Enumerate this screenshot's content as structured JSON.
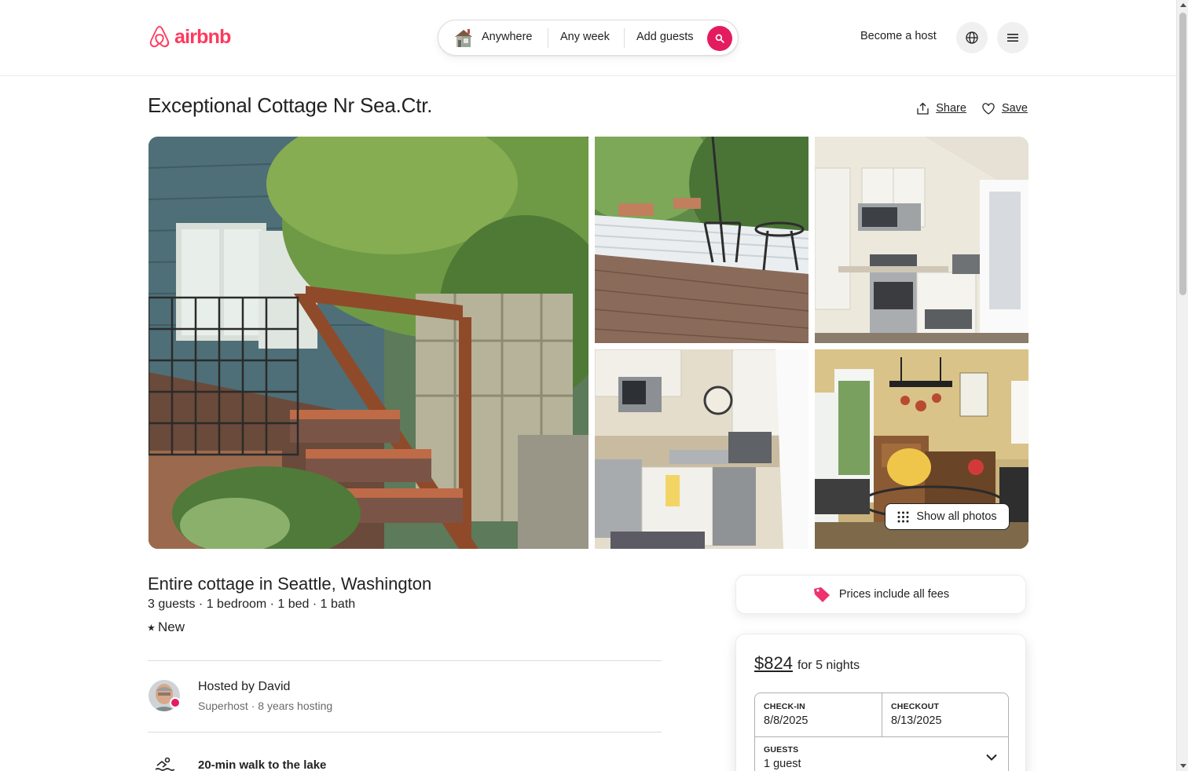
{
  "header": {
    "logo_text": "airbnb",
    "search": {
      "where": "Anywhere",
      "when": "Any week",
      "who": "Add guests"
    },
    "become_host": "Become a host",
    "brand_color": "#ff385c"
  },
  "listing": {
    "title": "Exceptional Cottage Nr Sea.Ctr.",
    "actions": {
      "share": "Share",
      "save": "Save"
    },
    "gallery": {
      "show_all": "Show all photos"
    },
    "subtitle": "Entire cottage in Seattle, Washington",
    "details": "3 guests · 1 bedroom · 1 bed · 1 bath",
    "rating_label": "New",
    "host": {
      "name": "Hosted by David",
      "meta": "Superhost · 8 years hosting"
    },
    "highlights": [
      {
        "icon": "swimming-icon",
        "text": "20-min walk to the lake"
      }
    ]
  },
  "booking": {
    "fees_banner": "Prices include all fees",
    "price": "$824",
    "price_suffix": "for 5 nights",
    "checkin_label": "CHECK-IN",
    "checkin_value": "8/8/2025",
    "checkout_label": "CHECKOUT",
    "checkout_value": "8/13/2025",
    "guests_label": "GUESTS",
    "guests_value": "1 guest"
  }
}
